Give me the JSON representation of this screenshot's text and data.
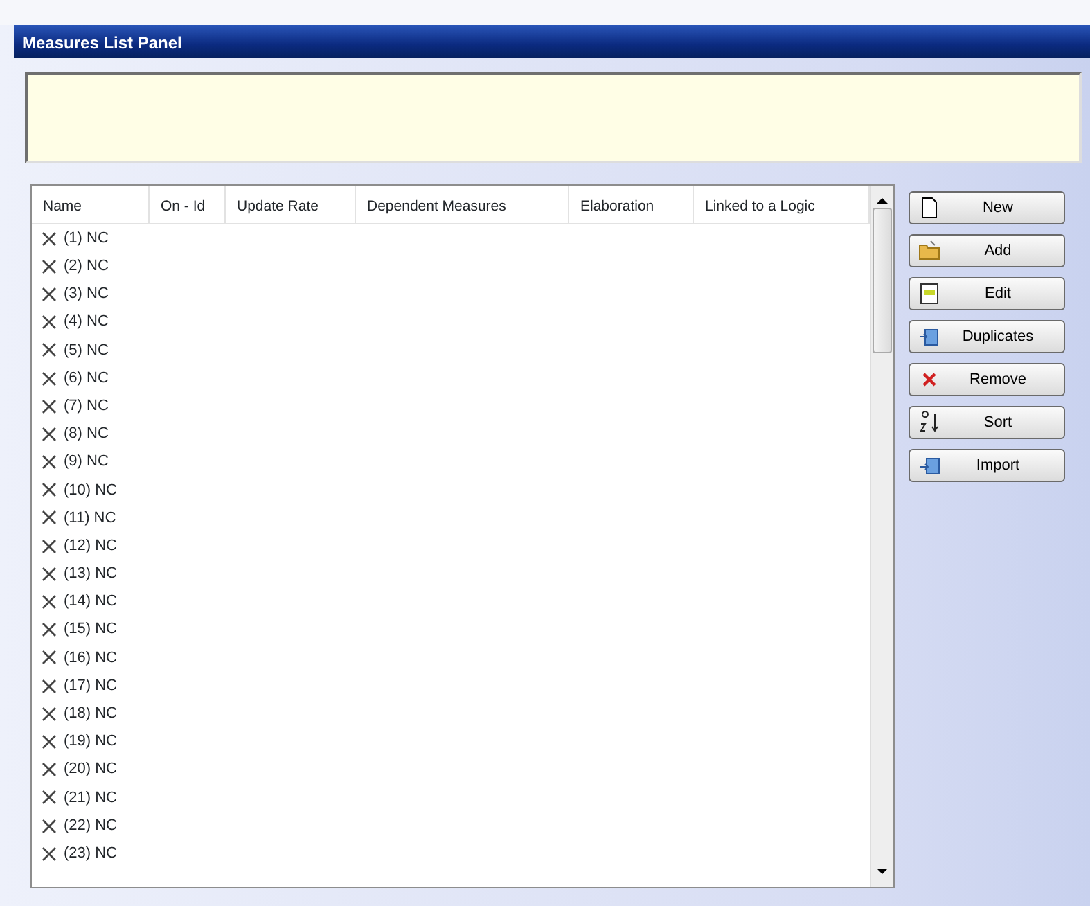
{
  "window": {
    "title": "Measures List Panel"
  },
  "table": {
    "columns": [
      "Name",
      "On - Id",
      "Update Rate",
      "Dependent Measures",
      "Elaboration",
      "Linked to a Logic"
    ],
    "rows": [
      {
        "name": "(1) NC"
      },
      {
        "name": "(2) NC"
      },
      {
        "name": "(3) NC"
      },
      {
        "name": "(4) NC"
      },
      {
        "name": "(5) NC"
      },
      {
        "name": "(6) NC"
      },
      {
        "name": "(7) NC"
      },
      {
        "name": "(8) NC"
      },
      {
        "name": "(9) NC"
      },
      {
        "name": "(10) NC"
      },
      {
        "name": "(11) NC"
      },
      {
        "name": "(12) NC"
      },
      {
        "name": "(13) NC"
      },
      {
        "name": "(14) NC"
      },
      {
        "name": "(15) NC"
      },
      {
        "name": "(16) NC"
      },
      {
        "name": "(17) NC"
      },
      {
        "name": "(18) NC"
      },
      {
        "name": "(19) NC"
      },
      {
        "name": "(20) NC"
      },
      {
        "name": "(21) NC"
      },
      {
        "name": "(22) NC"
      },
      {
        "name": "(23) NC"
      }
    ]
  },
  "buttons": [
    {
      "label": "New",
      "kind": "new"
    },
    {
      "label": "Add",
      "kind": "add"
    },
    {
      "label": "Edit",
      "kind": "edit"
    },
    {
      "label": "Duplicates",
      "kind": "duplicates"
    },
    {
      "label": "Remove",
      "kind": "remove"
    },
    {
      "label": "Sort",
      "kind": "sort"
    },
    {
      "label": "Import",
      "kind": "import"
    }
  ]
}
